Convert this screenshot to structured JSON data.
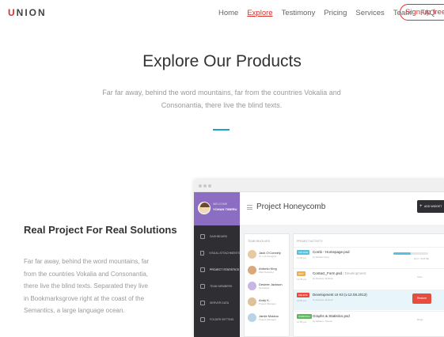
{
  "nav": {
    "logo_first": "U",
    "logo_rest": "NION",
    "links": [
      "Home",
      "Explore",
      "Testimony",
      "Pricing",
      "Services",
      "Team",
      "FAQ"
    ],
    "active_link": "Explore",
    "signup": "Sign up free"
  },
  "hero": {
    "title": "Explore Our Products",
    "lead": "Far far away, behind the word mountains, far from the countries Vokalia and Consonantia, there live the blind texts."
  },
  "feature": {
    "title": "Real Project For Real Solutions",
    "body": "Far far away, behind the word mountains, far from the countries Vokalia and Consonantia, there live the blind texts. Separated they live in Bookmarksgrove right at the coast of the Semantics, a large language ocean."
  },
  "app": {
    "profile": {
      "welcome": "WELCOME",
      "name": "YOHAN TIBERU"
    },
    "sidebar": [
      {
        "label": "DASHBOARD",
        "icon": "dashboard-icon"
      },
      {
        "label": "VISUAL ATTACHMENTS",
        "icon": "image-icon"
      },
      {
        "label": "PROJECT STATISTICS",
        "icon": "stats-icon"
      },
      {
        "label": "TEAM MEMBERS",
        "icon": "team-icon"
      },
      {
        "label": "SERVER DATA",
        "icon": "server-icon"
      },
      {
        "label": "FOLDER SETTING",
        "icon": "folder-icon"
      }
    ],
    "header": {
      "title": "Project Honeycomb",
      "widget_button": "ADD WIDGET"
    },
    "team": {
      "title": "TEAM INVOLVED",
      "members": [
        {
          "name": "Jack O'Connely",
          "role": "UI / UX Designer"
        },
        {
          "name": "Antonio King",
          "role": "Web Designer"
        },
        {
          "name": "Desiree Jackson",
          "role": "Developer"
        },
        {
          "name": "Andy K.",
          "role": "Project Manager"
        },
        {
          "name": "Jamie Molano",
          "role": "Project Manager"
        }
      ]
    },
    "activity": {
      "title": "PROJECT ACTIVITY",
      "rows": [
        {
          "badge": "UPLOAD",
          "badge_color": "#5bc0de",
          "time": "11:30 pm",
          "title": "Comb - Homepage.psd",
          "sub": "by Molano King",
          "progress": 0.5,
          "meta": "23.2 / 34.8 Mb"
        },
        {
          "badge": "EDIT",
          "badge_color": "#f0ad4e",
          "time": "11:45 pm",
          "title": "Contact_Form.psd",
          "title_extra": " / Development",
          "sub": "by Desiree Jackson",
          "action": "View"
        },
        {
          "badge": "DELETE",
          "badge_color": "#e84c3d",
          "time": "11:50 pm",
          "title": "Development UI Kit (v.12.08.2013)",
          "sub": "by Desiree Jackson",
          "restore": "Restore"
        },
        {
          "badge": "WORKING",
          "badge_color": "#5cb85c",
          "time": "11:55 pm",
          "title": "Graphs & Statistics.psd",
          "sub": "by Molano / Reese",
          "action": "Reply"
        }
      ]
    }
  }
}
